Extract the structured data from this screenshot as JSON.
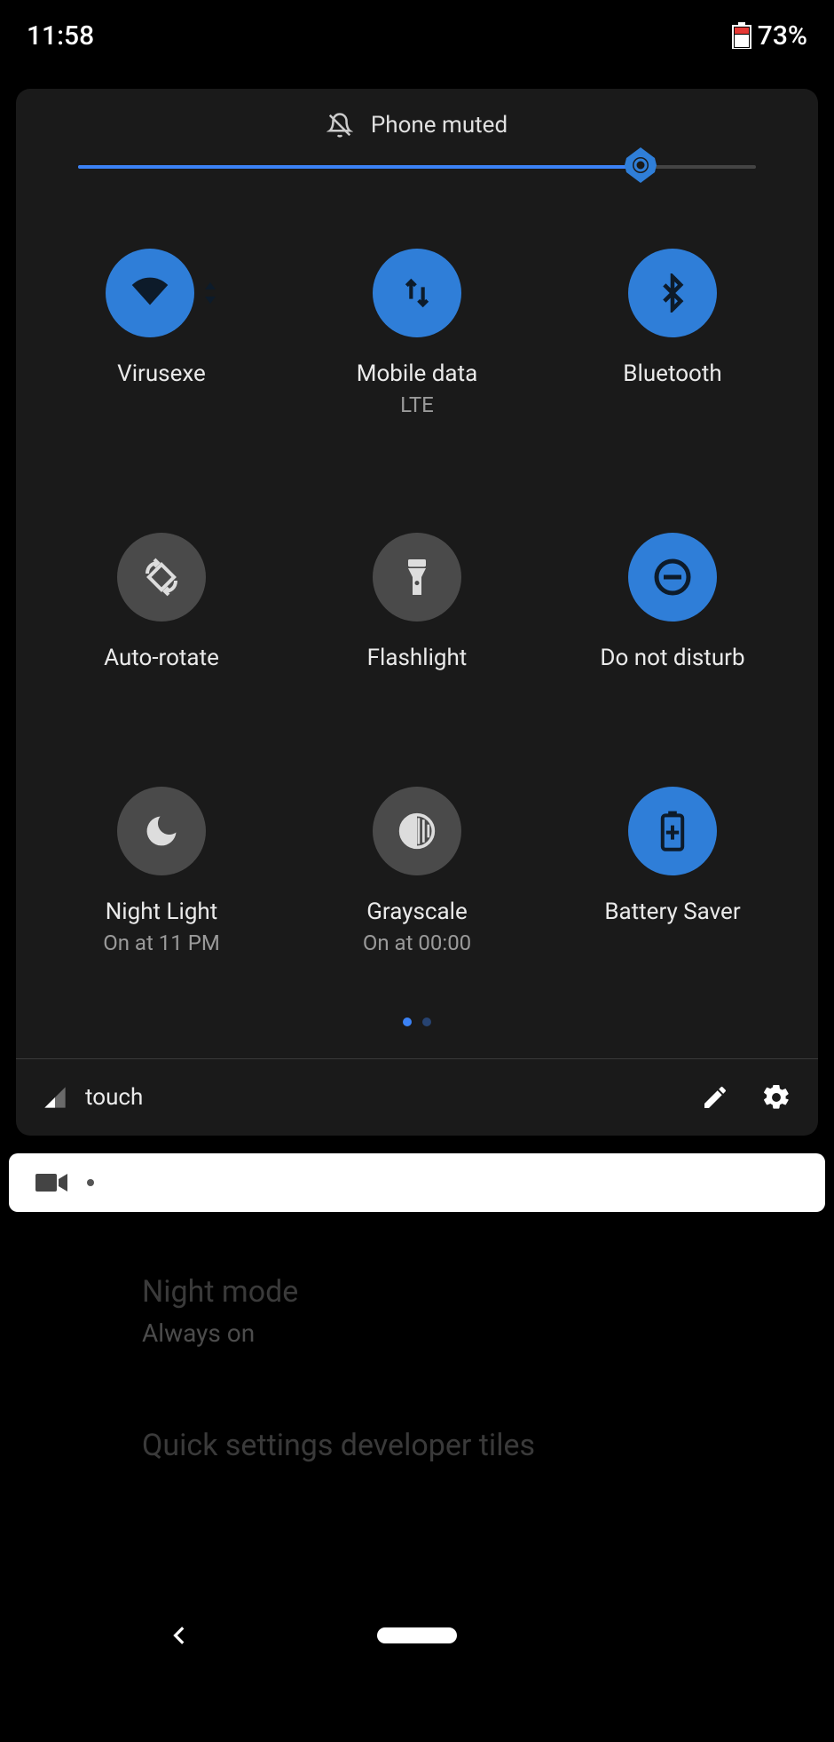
{
  "status": {
    "time": "11:58",
    "battery_pct": "73%"
  },
  "panel": {
    "header_text": "Phone muted",
    "brightness_pct": 83
  },
  "tiles": [
    {
      "label": "Virusexe",
      "sub": "",
      "active": true,
      "icon": "wifi"
    },
    {
      "label": "Mobile data",
      "sub": "LTE",
      "active": true,
      "icon": "mobile-data"
    },
    {
      "label": "Bluetooth",
      "sub": "",
      "active": true,
      "icon": "bluetooth"
    },
    {
      "label": "Auto-rotate",
      "sub": "",
      "active": false,
      "icon": "auto-rotate"
    },
    {
      "label": "Flashlight",
      "sub": "",
      "active": false,
      "icon": "flashlight"
    },
    {
      "label": "Do not disturb",
      "sub": "",
      "active": true,
      "icon": "dnd"
    },
    {
      "label": "Night Light",
      "sub": "On at 11 PM",
      "active": false,
      "icon": "night-light"
    },
    {
      "label": "Grayscale",
      "sub": "On at 00:00",
      "active": false,
      "icon": "grayscale"
    },
    {
      "label": "Battery Saver",
      "sub": "",
      "active": true,
      "icon": "battery-saver"
    }
  ],
  "footer": {
    "carrier": "touch"
  },
  "background": {
    "item1_title": "Night mode",
    "item1_sub": "Always on",
    "item2_title": "Quick settings developer tiles"
  },
  "colors": {
    "accent": "#2f7ed8",
    "panel_bg": "#1a1a1a",
    "tile_off": "#4a4a4a"
  }
}
